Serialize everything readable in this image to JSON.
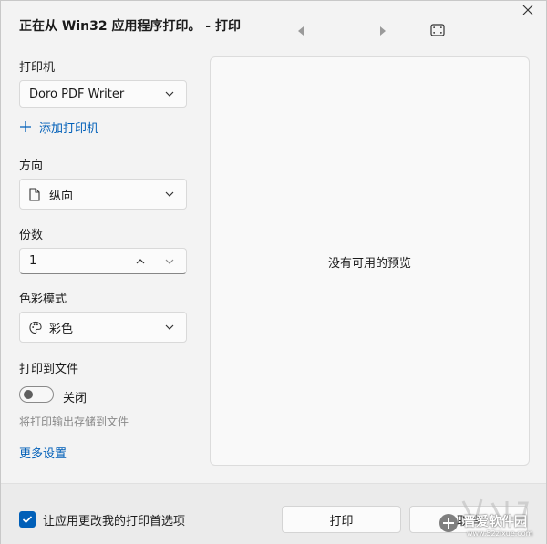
{
  "title": "正在从 Win32 应用程序打印。 - 打印",
  "printer": {
    "label": "打印机",
    "selected": "Doro PDF Writer",
    "add_label": "添加打印机"
  },
  "orientation": {
    "label": "方向",
    "selected": "纵向"
  },
  "copies": {
    "label": "份数",
    "value": "1"
  },
  "color_mode": {
    "label": "色彩模式",
    "selected": "彩色"
  },
  "print_to_file": {
    "label": "打印到文件",
    "state_label": "关闭",
    "hint": "将打印输出存储到文件"
  },
  "more_settings": "更多设置",
  "preview": {
    "message": "没有可用的预览"
  },
  "footer": {
    "checkbox_label": "让应用更改我的打印首选项",
    "print_button": "打印",
    "cancel_button": "取消"
  },
  "watermark": {
    "text": "晋爱软件园",
    "url": "www.52zixue.com"
  },
  "colors": {
    "accent": "#005fb8",
    "background": "#f3f3f3"
  }
}
